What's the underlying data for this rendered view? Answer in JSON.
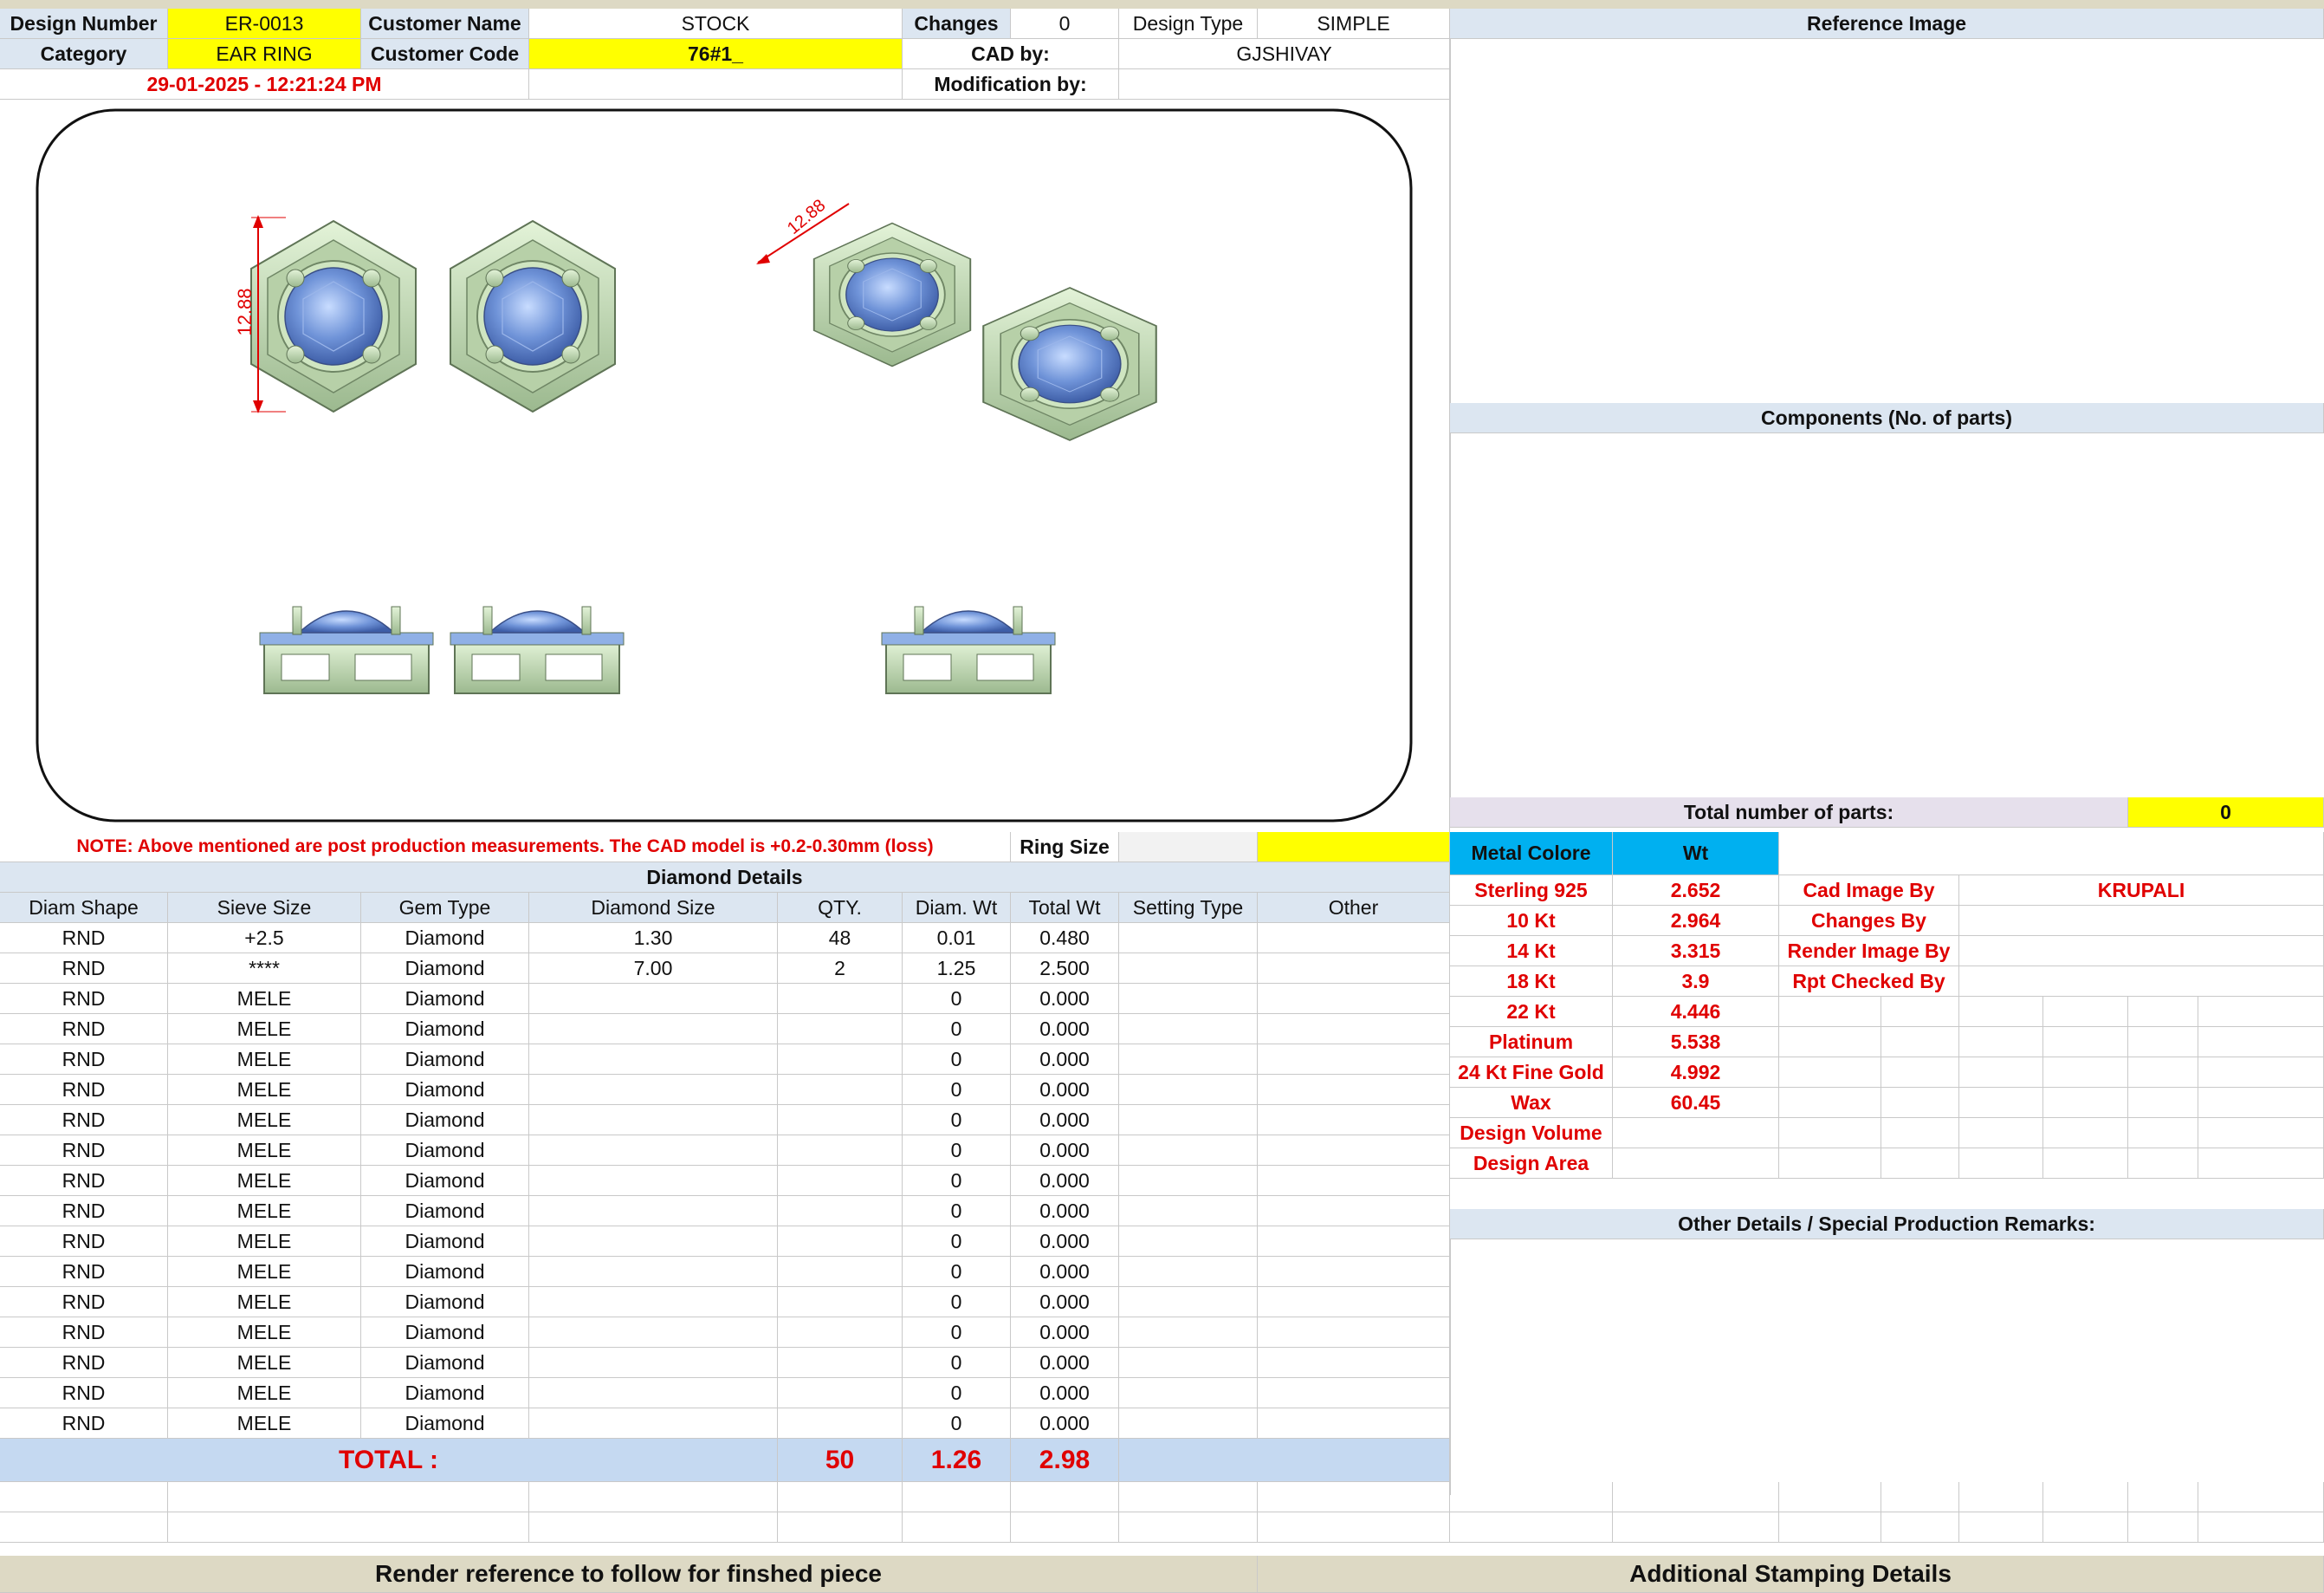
{
  "header": {
    "design_number_label": "Design Number",
    "design_number": "ER-0013",
    "customer_name_label": "Customer Name",
    "customer_name": "STOCK",
    "changes_label": "Changes",
    "changes": "0",
    "design_type_label": "Design Type",
    "design_type": "SIMPLE",
    "category_label": "Category",
    "category": "EAR RING",
    "customer_code_label": "Customer Code",
    "customer_code": "76#1_",
    "cad_by_label": "CAD by:",
    "cad_by": "GJSHIVAY",
    "timestamp": "29-01-2025 - 12:21:24 PM",
    "modification_by_label": "Modification by:",
    "modification_by": ""
  },
  "right_panel": {
    "reference_image": "Reference Image",
    "components": "Components (No. of parts)",
    "total_parts_label": "Total number of parts:",
    "total_parts": "0",
    "other_details": "Other Details / Special Production Remarks:"
  },
  "render": {
    "dimension_front": "12.88",
    "dimension_iso": "12.88"
  },
  "note": {
    "text": "NOTE: Above mentioned are post production measurements. The CAD model is +0.2-0.30mm (loss)",
    "ring_size_label": "Ring Size",
    "ring_size": ""
  },
  "metal": {
    "header_color": "Metal Colore",
    "header_wt": "Wt",
    "rows": [
      {
        "name": "Sterling 925",
        "wt": "2.652"
      },
      {
        "name": "10 Kt",
        "wt": "2.964"
      },
      {
        "name": "14 Kt",
        "wt": "3.315"
      },
      {
        "name": "18 Kt",
        "wt": "3.9"
      },
      {
        "name": "22 Kt",
        "wt": "4.446"
      },
      {
        "name": "Platinum",
        "wt": "5.538"
      },
      {
        "name": "24 Kt Fine Gold",
        "wt": "4.992"
      },
      {
        "name": "Wax",
        "wt": "60.45"
      },
      {
        "name": "Design Volume",
        "wt": ""
      },
      {
        "name": "Design Area",
        "wt": ""
      }
    ]
  },
  "credits": [
    {
      "label": "Cad Image By",
      "value": "KRUPALI"
    },
    {
      "label": "Changes By",
      "value": ""
    },
    {
      "label": "Render Image By",
      "value": ""
    },
    {
      "label": "Rpt Checked By",
      "value": ""
    }
  ],
  "diamond": {
    "title": "Diamond Details",
    "columns": [
      "Diam Shape",
      "Sieve Size",
      "Gem Type",
      "Diamond Size",
      "QTY.",
      "Diam. Wt",
      "Total Wt",
      "Setting Type",
      "Other"
    ],
    "rows": [
      [
        "RND",
        "+2.5",
        "Diamond",
        "1.30",
        "48",
        "0.01",
        "0.480",
        "",
        ""
      ],
      [
        "RND",
        "****",
        "Diamond",
        "7.00",
        "2",
        "1.25",
        "2.500",
        "",
        ""
      ],
      [
        "RND",
        "MELE",
        "Diamond",
        "",
        "",
        "0",
        "0.000",
        "",
        ""
      ],
      [
        "RND",
        "MELE",
        "Diamond",
        "",
        "",
        "0",
        "0.000",
        "",
        ""
      ],
      [
        "RND",
        "MELE",
        "Diamond",
        "",
        "",
        "0",
        "0.000",
        "",
        ""
      ],
      [
        "RND",
        "MELE",
        "Diamond",
        "",
        "",
        "0",
        "0.000",
        "",
        ""
      ],
      [
        "RND",
        "MELE",
        "Diamond",
        "",
        "",
        "0",
        "0.000",
        "",
        ""
      ],
      [
        "RND",
        "MELE",
        "Diamond",
        "",
        "",
        "0",
        "0.000",
        "",
        ""
      ],
      [
        "RND",
        "MELE",
        "Diamond",
        "",
        "",
        "0",
        "0.000",
        "",
        ""
      ],
      [
        "RND",
        "MELE",
        "Diamond",
        "",
        "",
        "0",
        "0.000",
        "",
        ""
      ],
      [
        "RND",
        "MELE",
        "Diamond",
        "",
        "",
        "0",
        "0.000",
        "",
        ""
      ],
      [
        "RND",
        "MELE",
        "Diamond",
        "",
        "",
        "0",
        "0.000",
        "",
        ""
      ],
      [
        "RND",
        "MELE",
        "Diamond",
        "",
        "",
        "0",
        "0.000",
        "",
        ""
      ],
      [
        "RND",
        "MELE",
        "Diamond",
        "",
        "",
        "0",
        "0.000",
        "",
        ""
      ],
      [
        "RND",
        "MELE",
        "Diamond",
        "",
        "",
        "0",
        "0.000",
        "",
        ""
      ],
      [
        "RND",
        "MELE",
        "Diamond",
        "",
        "",
        "0",
        "0.000",
        "",
        ""
      ],
      [
        "RND",
        "MELE",
        "Diamond",
        "",
        "",
        "0",
        "0.000",
        "",
        ""
      ]
    ],
    "total_label": "TOTAL :",
    "total_qty": "50",
    "total_diam_wt": "1.26",
    "total_wt": "2.98"
  },
  "footer": {
    "left": "Render reference to follow for finshed piece",
    "right": "Additional Stamping Details"
  }
}
